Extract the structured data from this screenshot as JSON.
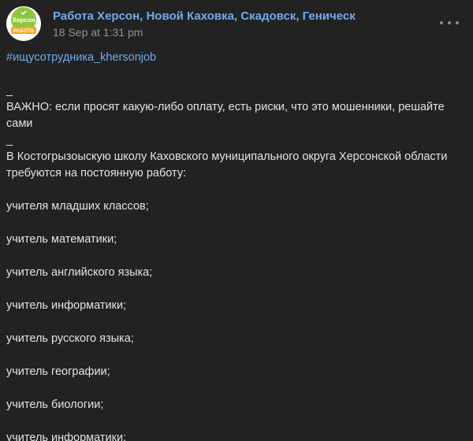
{
  "post": {
    "group_name": "Работа Херсон, Новой Каховка, Скадовск, Геническ",
    "date": "18 Sep at 1:31 pm",
    "avatar": {
      "top_text": "Херсон",
      "badge_text": "РАБОТА",
      "colors": {
        "circle": "#8dc63f",
        "badge": "#f6a623",
        "check": "#ffffff"
      }
    },
    "more_icon": "more-horizontal-icon",
    "hashtag": "#ищусотрудника_khersonjob",
    "separator_1": "_",
    "warning": "ВАЖНО: если просят какую-либо оплату, есть риски, что это мошенники, решайте сами",
    "separator_2": "_",
    "intro": "В Костогрызоыскую школу Каховского муниципального округа Херсонской области требуются на постоянную работу:",
    "vacancies": [
      "учителя младших классов;",
      "учитель математики;",
      "учитель английского языка;",
      "учитель информатики;",
      "учитель русского языка;",
      "учитель географии;",
      "учитель биологии;",
      "учитель информатики;"
    ]
  },
  "colors": {
    "background": "#222222",
    "text": "#e1e3e6",
    "link": "#71aaeb",
    "muted": "#939393"
  }
}
